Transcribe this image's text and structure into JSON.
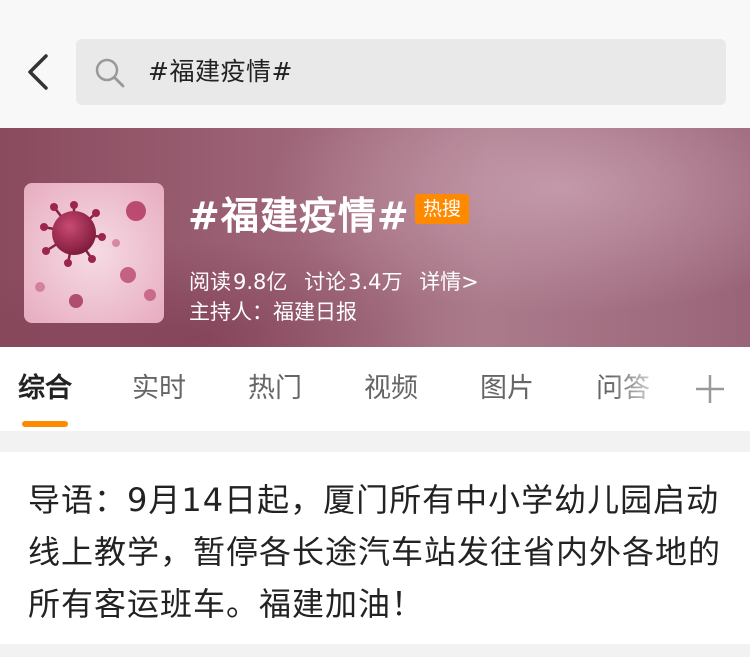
{
  "search": {
    "query": "#福建疫情#"
  },
  "topic": {
    "title": "#福建疫情#",
    "badge": "热搜",
    "read_label": "阅读",
    "read_count": "9.8亿",
    "discuss_label": "讨论",
    "discuss_count": "3.4万",
    "details_link": "详情>",
    "host": "主持人：福建日报"
  },
  "tabs": [
    {
      "label": "综合",
      "active": true
    },
    {
      "label": "实时",
      "active": false
    },
    {
      "label": "热门",
      "active": false
    },
    {
      "label": "视频",
      "active": false
    },
    {
      "label": "图片",
      "active": false
    },
    {
      "label": "问答",
      "active": false
    }
  ],
  "intro": {
    "text": "导语：9月14日起，厦门所有中小学幼儿园启动线上教学，暂停各长途汽车站发往省内外各地的所有客运班车。福建加油！"
  },
  "icons": {
    "back": "chevron-left-icon",
    "search": "search-icon",
    "add_tab": "plus-icon"
  },
  "colors": {
    "accent": "#ff8a00",
    "banner": "#9c6275",
    "text": "#222222"
  }
}
